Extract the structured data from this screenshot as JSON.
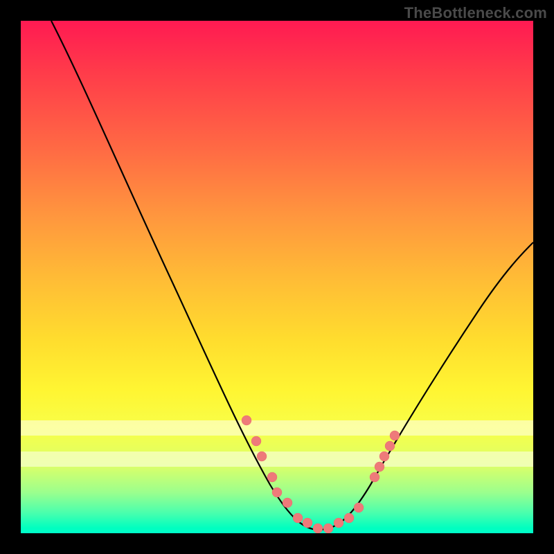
{
  "watermark": "TheBottleneck.com",
  "chart_data": {
    "type": "line",
    "title": "",
    "xlabel": "",
    "ylabel": "",
    "xlim": [
      0,
      100
    ],
    "ylim": [
      0,
      100
    ],
    "grid": false,
    "legend": false,
    "series": [
      {
        "name": "bottleneck-curve",
        "color": "#000000",
        "x": [
          6,
          10,
          15,
          20,
          25,
          30,
          35,
          40,
          43,
          46,
          49,
          52,
          55,
          58,
          61,
          64,
          68,
          72,
          76,
          80,
          85,
          90,
          95,
          100
        ],
        "y": [
          100,
          92,
          82,
          72,
          62,
          52,
          42,
          32,
          25,
          18,
          11,
          6,
          3,
          1,
          1,
          2,
          5,
          10,
          17,
          24,
          33,
          42,
          50,
          57
        ]
      }
    ],
    "markers": [
      {
        "x": 44,
        "y": 22,
        "color": "#ee7a7a"
      },
      {
        "x": 46,
        "y": 18,
        "color": "#ee7a7a"
      },
      {
        "x": 47,
        "y": 15,
        "color": "#ee7a7a"
      },
      {
        "x": 49,
        "y": 11,
        "color": "#ee7a7a"
      },
      {
        "x": 50,
        "y": 8,
        "color": "#ee7a7a"
      },
      {
        "x": 52,
        "y": 6,
        "color": "#ee7a7a"
      },
      {
        "x": 54,
        "y": 3,
        "color": "#ee7a7a"
      },
      {
        "x": 56,
        "y": 2,
        "color": "#ee7a7a"
      },
      {
        "x": 58,
        "y": 1,
        "color": "#ee7a7a"
      },
      {
        "x": 60,
        "y": 1,
        "color": "#ee7a7a"
      },
      {
        "x": 62,
        "y": 2,
        "color": "#ee7a7a"
      },
      {
        "x": 64,
        "y": 3,
        "color": "#ee7a7a"
      },
      {
        "x": 66,
        "y": 5,
        "color": "#ee7a7a"
      },
      {
        "x": 69,
        "y": 11,
        "color": "#ee7a7a"
      },
      {
        "x": 70,
        "y": 13,
        "color": "#ee7a7a"
      },
      {
        "x": 71,
        "y": 15,
        "color": "#ee7a7a"
      },
      {
        "x": 72,
        "y": 17,
        "color": "#ee7a7a"
      },
      {
        "x": 73,
        "y": 19,
        "color": "#ee7a7a"
      }
    ],
    "bands": [
      {
        "name": "pale-band-upper",
        "y_from": 22,
        "y_to": 19,
        "opacity": 0.55
      },
      {
        "name": "pale-band-lower",
        "y_from": 16,
        "y_to": 13,
        "opacity": 0.55
      }
    ],
    "gradient_stops": [
      {
        "pos": 0,
        "color": "#ff1a52"
      },
      {
        "pos": 50,
        "color": "#ffbb36"
      },
      {
        "pos": 80,
        "color": "#f7ff4a"
      },
      {
        "pos": 100,
        "color": "#00ffca"
      }
    ]
  }
}
